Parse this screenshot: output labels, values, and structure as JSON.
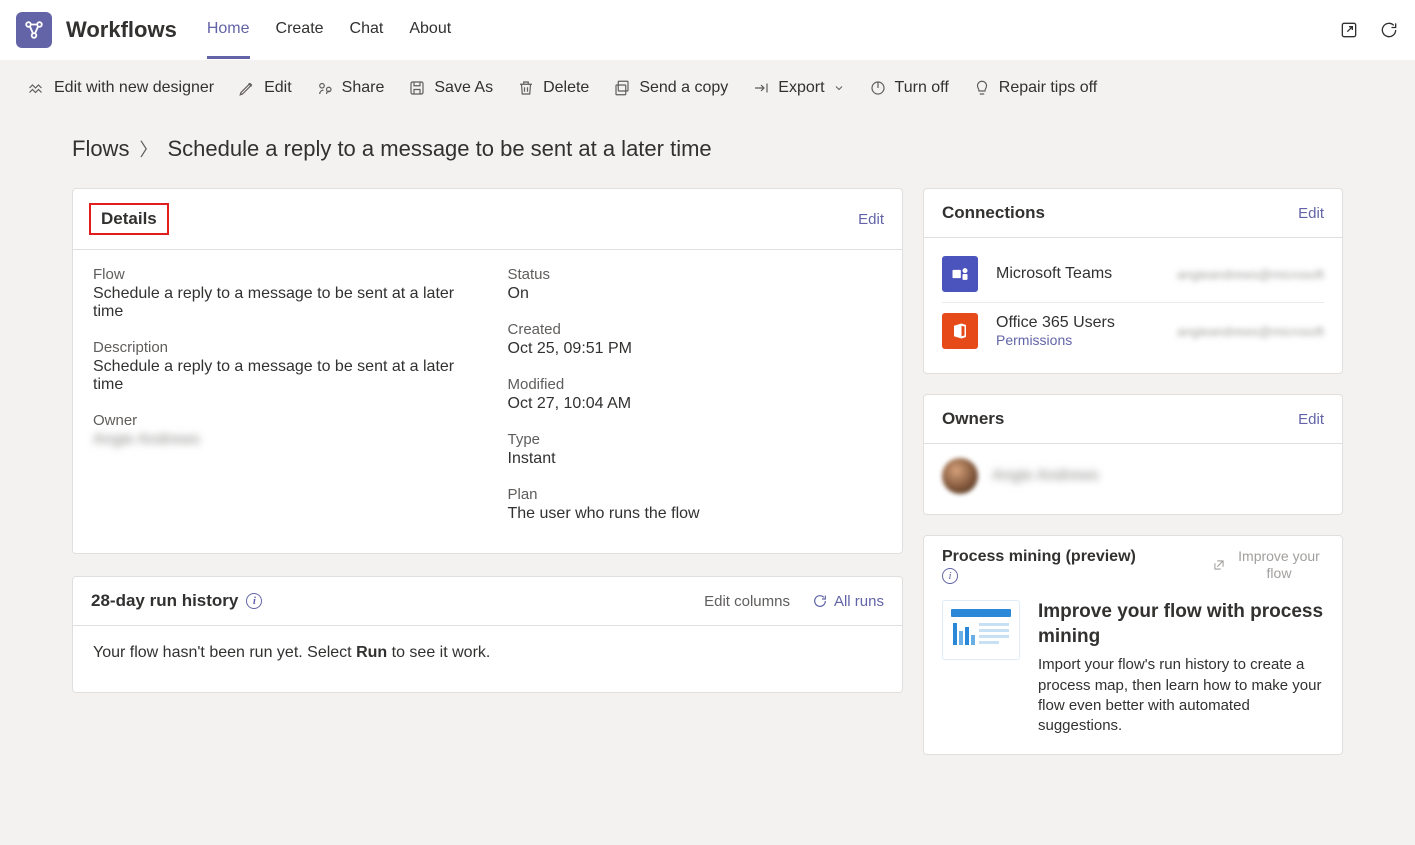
{
  "app": {
    "title": "Workflows"
  },
  "nav": {
    "home": "Home",
    "create": "Create",
    "chat": "Chat",
    "about": "About"
  },
  "toolbar": {
    "edit_new_designer": "Edit with new designer",
    "edit": "Edit",
    "share": "Share",
    "save_as": "Save As",
    "delete": "Delete",
    "send_copy": "Send a copy",
    "export": "Export",
    "turn_off": "Turn off",
    "repair_tips_off": "Repair tips off"
  },
  "breadcrumb": {
    "root": "Flows",
    "current": "Schedule a reply to a message to be sent at a later time"
  },
  "details": {
    "title": "Details",
    "edit": "Edit",
    "flow_label": "Flow",
    "flow_value": "Schedule a reply to a message to be sent at a later time",
    "description_label": "Description",
    "description_value": "Schedule a reply to a message to be sent at a later time",
    "owner_label": "Owner",
    "owner_value": "Angie Andrews",
    "status_label": "Status",
    "status_value": "On",
    "created_label": "Created",
    "created_value": "Oct 25, 09:51 PM",
    "modified_label": "Modified",
    "modified_value": "Oct 27, 10:04 AM",
    "type_label": "Type",
    "type_value": "Instant",
    "plan_label": "Plan",
    "plan_value": "The user who runs the flow"
  },
  "run_history": {
    "title": "28-day run history",
    "edit_columns": "Edit columns",
    "all_runs": "All runs",
    "message_prefix": "Your flow hasn't been run yet. Select ",
    "message_bold": "Run",
    "message_suffix": " to see it work."
  },
  "connections": {
    "title": "Connections",
    "edit": "Edit",
    "items": [
      {
        "name": "Microsoft Teams",
        "account": "angieandrews@microsoft",
        "perm": null
      },
      {
        "name": "Office 365 Users",
        "account": "angieandrews@microsoft",
        "perm": "Permissions"
      }
    ]
  },
  "owners": {
    "title": "Owners",
    "edit": "Edit",
    "name": "Angie Andrews"
  },
  "process_mining": {
    "title": "Process mining (preview)",
    "improve_link": "Improve your flow",
    "heading": "Improve your flow with process mining",
    "desc": "Import your flow's run history to create a process map, then learn how to make your flow even better with automated suggestions."
  }
}
